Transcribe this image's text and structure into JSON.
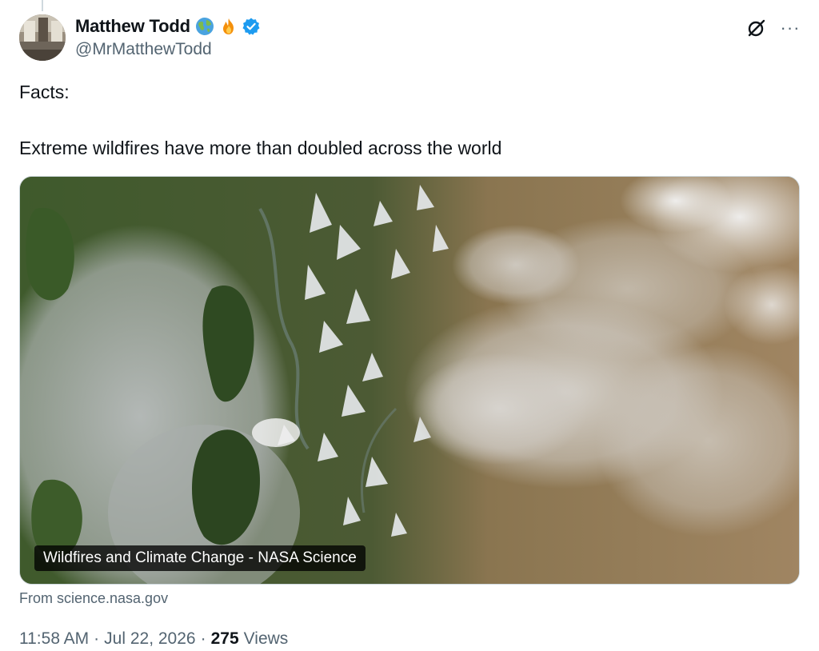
{
  "author": {
    "display_name": "Matthew Todd",
    "handle": "@MrMatthewTodd",
    "name_emojis": [
      "globe-emoji",
      "fire-emoji"
    ],
    "verified": true,
    "verified_color": "#1d9bf0"
  },
  "tweet": {
    "paragraphs": [
      "Facts:",
      "Extreme wildfires have more than doubled across the world"
    ]
  },
  "card": {
    "title": "Wildfires and Climate Change - NASA Science",
    "source": "From science.nasa.gov",
    "image_subject": "satellite-wildfire-smoke-image"
  },
  "meta": {
    "time": "11:58 AM",
    "separator": "·",
    "date": "Jul 22, 2026",
    "views_count": "275",
    "views_label": "Views"
  },
  "actions": {
    "grok_icon": "grok-icon",
    "more_icon": "more-icon",
    "more_label": "···"
  },
  "colors": {
    "text_primary": "#0f1419",
    "text_secondary": "#536471",
    "border": "#cfd9de"
  }
}
